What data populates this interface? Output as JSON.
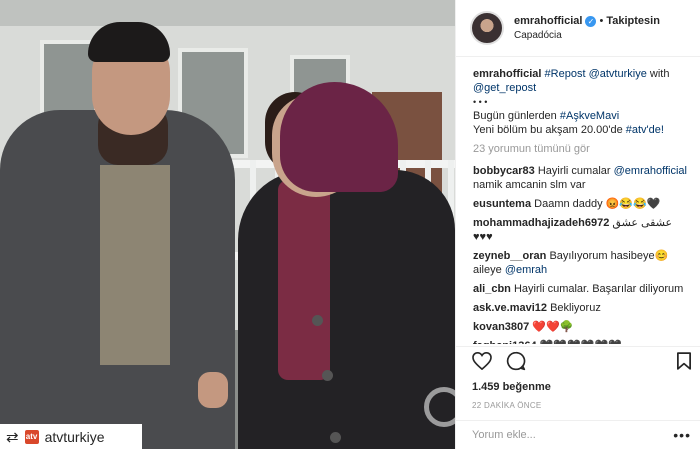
{
  "post": {
    "username": "emrahofficial",
    "follow_label": "Takiptesin",
    "location": "Capadócia",
    "repost_label": "atvturkiye",
    "likes": "1.459 beğenme",
    "time": "22 DAKİKA ÖNCE",
    "add_comment_placeholder": "Yorum ekle...",
    "view_all": "23 yorumun tümünü gör"
  },
  "caption": {
    "user": "emrahofficial",
    "line1_tag": "#Repost",
    "line1_mention": "@atvturkiye",
    "line1_text": "with",
    "line1_mention2": "@get_repost",
    "dots": "• • •",
    "line2_text": "Bugün günlerden",
    "line2_tag": "#AşkveMavi",
    "line3_text": "Yeni bölüm bu akşam 20.00'de",
    "line3_tag": "#atv'de!"
  },
  "comments": [
    {
      "user": "bobbycar83",
      "text": "Hayirli cumalar",
      "mention": "@emrahofficial",
      "text2": "namik amcanin slm var"
    },
    {
      "user": "eusuntema",
      "text": "Daamn daddy 😡😂😂🖤"
    },
    {
      "user": "mohammadhajizadeh6972",
      "text": "عشقی عشق ♥♥♥"
    },
    {
      "user": "zeyneb__oran",
      "text": "Bayılıyorum hasibeye😊aileye",
      "mention": "@emrah"
    },
    {
      "user": "ali_cbn",
      "text": "Hayirli cumalar. Başarılar diliyorum"
    },
    {
      "user": "ask.ve.mavi12",
      "text": "Bekliyoruz"
    },
    {
      "user": "kovan3807",
      "text": "❤️❤️🌳"
    },
    {
      "user": "faghani1364",
      "text": "🖤🖤🖤🖤🖤🖤"
    }
  ],
  "icons": {
    "like": "heart-icon",
    "comment": "comment-icon",
    "save": "bookmark-icon",
    "more": "more-options-icon",
    "repost": "repost-icon",
    "verified": "verified-badge-icon"
  },
  "colors": {
    "link": "#003569",
    "muted": "#999999",
    "verified": "#3897f0"
  }
}
